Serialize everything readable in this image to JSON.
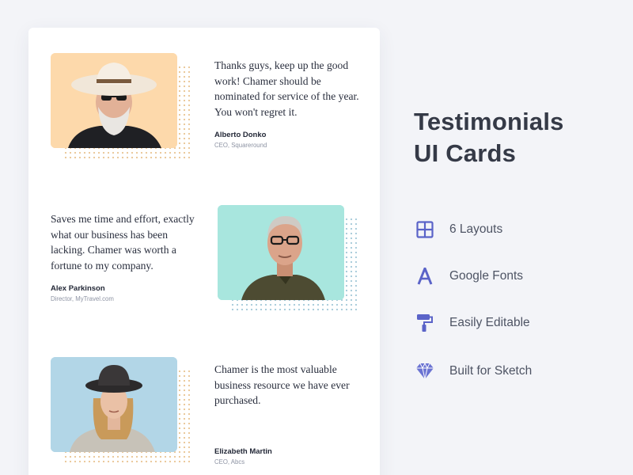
{
  "testimonials": [
    {
      "quote": "Thanks guys, keep up the good work! Chamer should be nominated for service of the year. You won't regret it.",
      "author": "Alberto Donko",
      "role": "CEO, Squareround"
    },
    {
      "quote": "Saves me time and effort, exactly what our business has been lacking. Chamer was worth a fortune to my company.",
      "author": "Alex Parkinson",
      "role": "Director, MyTravel.com"
    },
    {
      "quote": "Chamer is the most valuable business resource we have ever purchased.",
      "author": "Elizabeth Martin",
      "role": "CEO, Abcs"
    }
  ],
  "headline": {
    "line1": "Testimonials",
    "line2": "UI Cards"
  },
  "features": [
    {
      "icon": "grid-layout-icon",
      "label": "6 Layouts"
    },
    {
      "icon": "letter-a-font-icon",
      "label": "Google Fonts"
    },
    {
      "icon": "paint-roller-icon",
      "label": "Easily Editable"
    },
    {
      "icon": "sketch-diamond-icon",
      "label": "Built for Sketch"
    }
  ],
  "colors": {
    "background": "#f3f4f8",
    "card": "#ffffff",
    "accent": "#5a63c8",
    "photo1_bg": "#fdd9ab",
    "photo2_bg": "#a8e6de",
    "photo3_bg": "#b2d6e7"
  }
}
